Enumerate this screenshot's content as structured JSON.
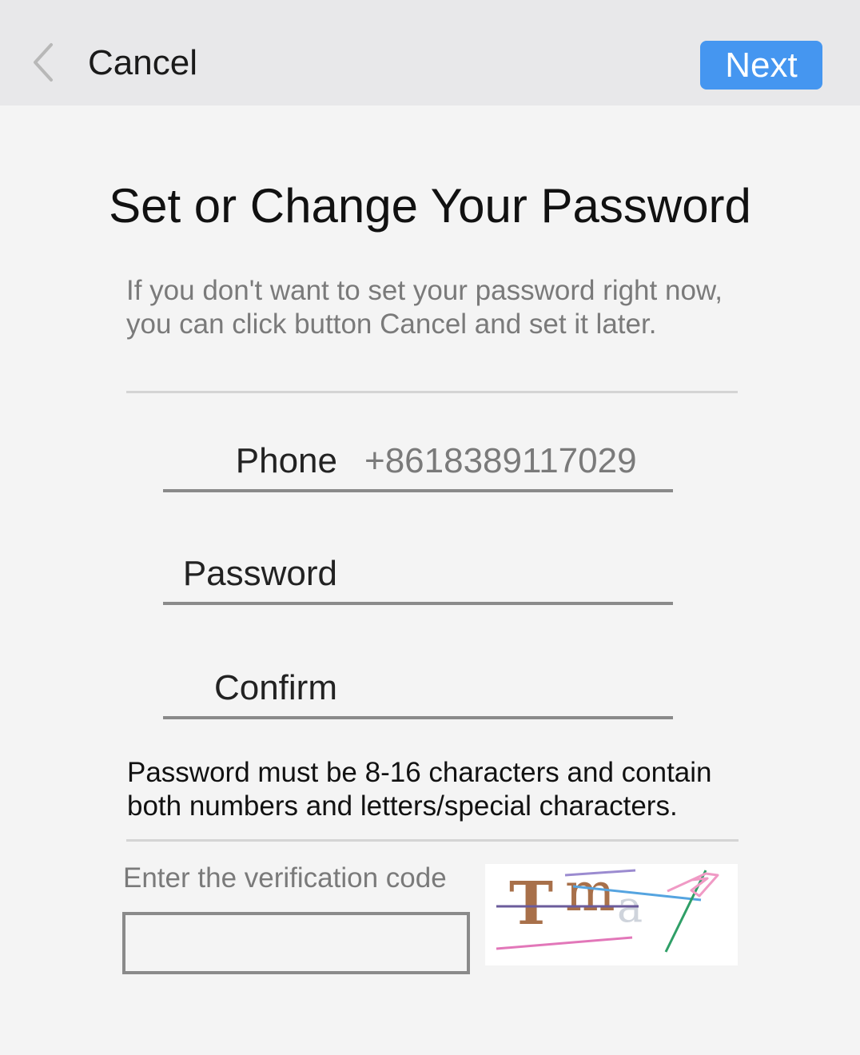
{
  "topbar": {
    "back_icon": "chevron-left-icon",
    "cancel_label": "Cancel",
    "next_label": "Next",
    "accent_color": "#4596f0"
  },
  "main": {
    "title": "Set or Change Your Password",
    "info": "If you don't want to set your password right now, you can click button Cancel and set it later.",
    "phone": {
      "label": "Phone",
      "value": "+8618389117029"
    },
    "password": {
      "label": "Password",
      "value": ""
    },
    "confirm": {
      "label": "Confirm",
      "value": ""
    },
    "rule": "Password must be 8-16 characters and contain both numbers and letters/special characters.",
    "verification": {
      "label": "Enter the verification code",
      "value": "",
      "captcha_text": "Tma"
    }
  }
}
